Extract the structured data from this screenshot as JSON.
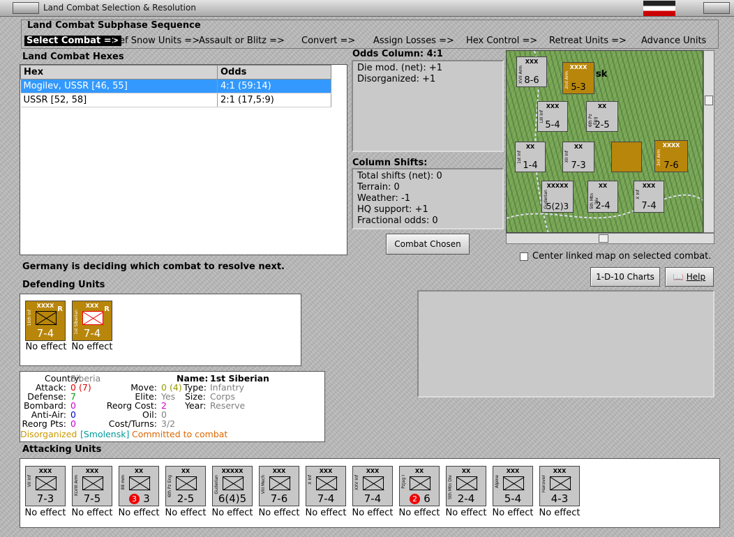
{
  "window": {
    "title": "Land Combat Selection & Resolution"
  },
  "sequence": {
    "heading": "Land Combat Subphase Sequence",
    "steps": [
      "Select Combat =>",
      "Def Snow Units =>",
      "Assault or Blitz =>",
      "Convert =>",
      "Assign Losses =>",
      "Hex Control =>",
      "Retreat Units =>",
      "Advance Units"
    ]
  },
  "hexes": {
    "heading": "Land Combat Hexes",
    "columns": [
      "Hex",
      "Odds"
    ],
    "rows": [
      {
        "hex": "Mogilev, USSR [46, 55]",
        "odds": "4:1 (59:14)"
      },
      {
        "hex": "USSR [52, 58]",
        "odds": "2:1 (17,5:9)"
      }
    ]
  },
  "odds": {
    "heading": "Odds Column: 4:1",
    "lines": [
      "Die mod. (net): +1",
      "Disorganized: +1"
    ]
  },
  "shifts": {
    "heading": "Column Shifts:",
    "lines": [
      "Total shifts (net): 0",
      "Terrain: 0",
      "Weather: -1",
      "HQ support: +1",
      "Fractional odds: 0"
    ]
  },
  "buttons": {
    "combat_chosen": "Combat Chosen",
    "charts": "1-D-10 Charts",
    "help": "Help"
  },
  "center_map": "Center linked map on selected combat.",
  "status": "Germany is deciding which combat to resolve next.",
  "defending": {
    "heading": "Defending Units",
    "units": [
      {
        "size": "XXXX",
        "name": "16th Inf",
        "strength": "7-4",
        "flag": "R",
        "effect": "No effect"
      },
      {
        "size": "XXX",
        "name": "1st Siberian",
        "strength": "7-4",
        "flag": "R",
        "effect": "No effect"
      }
    ]
  },
  "details": {
    "country_label": "Country:",
    "country": "Siberia",
    "attack_label": "Attack:",
    "attack": "0",
    "attack_alt": "(7)",
    "defense_label": "Defense:",
    "defense": "7",
    "bombard_label": "Bombard:",
    "bombard": "0",
    "antiair_label": "Anti-Air:",
    "antiair": "0",
    "reorg_label": "Reorg Pts:",
    "reorg": "0",
    "name_label": "Name:",
    "name": "1st Siberian",
    "move_label": "Move:",
    "move": "0",
    "move_alt": "(4)",
    "elite_label": "Elite:",
    "elite": "Yes",
    "reorgcost_label": "Reorg Cost:",
    "reorgcost": "2",
    "oil_label": "Oil:",
    "oil": "0",
    "cost_label": "Cost/Turns:",
    "cost": "3/2",
    "type_label": "Type:",
    "type": "Infantry",
    "size_label": "Size:",
    "size": "Corps",
    "year_label": "Year:",
    "year": "Reserve",
    "status1": "Disorganized",
    "status2": "[Smolensk]",
    "status3": "Committed to combat"
  },
  "attacking": {
    "heading": "Attacking Units",
    "units": [
      {
        "size": "XXX",
        "name": "VII Inf",
        "strength": "7-3",
        "effect": "No effect"
      },
      {
        "size": "XXX",
        "name": "XLVIII Arm",
        "strength": "7-5",
        "effect": "No effect"
      },
      {
        "size": "XX",
        "name": "88 mm",
        "strength": "3",
        "badge": "3",
        "effect": "No effect"
      },
      {
        "size": "XX",
        "name": "6th Pz Eng",
        "strength": "2-5",
        "effect": "No effect"
      },
      {
        "size": "XXXXX",
        "name": "Guderian",
        "strength": "6(4)5",
        "effect": "No effect"
      },
      {
        "size": "XXX",
        "name": "VIII Mech",
        "strength": "7-6",
        "effect": "No effect"
      },
      {
        "size": "XXX",
        "name": "X Inf",
        "strength": "7-4",
        "effect": "No effect"
      },
      {
        "size": "XXX",
        "name": "XXV Inf",
        "strength": "7-4",
        "effect": "No effect"
      },
      {
        "size": "XX",
        "name": "PzJag I",
        "strength": "6",
        "badge": "2",
        "effect": "No effect"
      },
      {
        "size": "XX",
        "name": "5th Mtn Div",
        "strength": "2-4",
        "effect": "No effect"
      },
      {
        "size": "XXX",
        "name": "Alpine",
        "strength": "5-4",
        "effect": "No effect"
      },
      {
        "size": "XXX",
        "name": "Hanover",
        "strength": "4-3",
        "effect": "No effect"
      }
    ]
  },
  "map": {
    "place": "sk",
    "counters": [
      {
        "size": "XXX",
        "name": "XVII Arm",
        "strength": "8-6"
      },
      {
        "size": "XXXX",
        "name": "2nd Arm",
        "strength": "5-3"
      },
      {
        "size": "XXX",
        "name": "LIII Inf",
        "strength": "5-4"
      },
      {
        "size": "XX",
        "name": "6th Pz Eng",
        "strength": "2-5"
      },
      {
        "size": "XX",
        "name": "1st Inf",
        "strength": "1-4"
      },
      {
        "size": "XX",
        "name": "XII Inf",
        "strength": "7-3"
      },
      {
        "size": "XXXX",
        "name": "3rd Arm",
        "strength": "7-6"
      },
      {
        "size": "XXXXX",
        "name": "Guderian",
        "strength": "5(2)3"
      },
      {
        "size": "XX",
        "name": "5th Mtn Div",
        "strength": "2-4"
      },
      {
        "size": "XXX",
        "name": "X Inf",
        "strength": "7-4"
      }
    ]
  }
}
